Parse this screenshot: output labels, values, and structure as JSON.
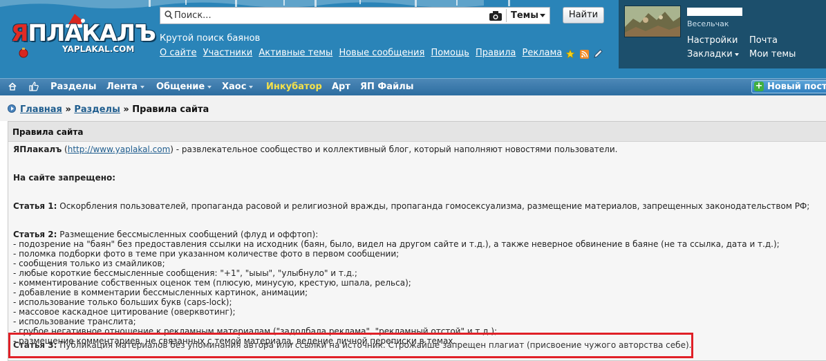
{
  "header": {
    "logo_text": "ЯПЛАКАЛЪ",
    "logo_sub": "YAPLAKAL.COM",
    "search": {
      "placeholder": "Поиск...",
      "scope": "Темы",
      "button": "Найти"
    },
    "tagline": "Крутой поиск баянов",
    "links": [
      "О сайте",
      "Участники",
      "Активные темы",
      "Новые сообщения",
      "Помощь",
      "Правила",
      "Реклама"
    ],
    "user": {
      "title": "Весельчак",
      "links": {
        "settings": "Настройки",
        "mail": "Почта",
        "bookmarks": "Закладки",
        "my_topics": "Мои темы"
      }
    }
  },
  "nav": {
    "items": [
      {
        "label": "Разделы",
        "dropdown": false
      },
      {
        "label": "Лента",
        "dropdown": true
      },
      {
        "label": "Общение",
        "dropdown": true
      },
      {
        "label": "Хаос",
        "dropdown": true
      },
      {
        "label": "Инкубатор",
        "dropdown": false
      },
      {
        "label": "Арт",
        "dropdown": false
      },
      {
        "label": "ЯП Файлы",
        "dropdown": false
      }
    ],
    "new_post": "Новый пост"
  },
  "breadcrumb": {
    "home": "Главная",
    "sections": "Разделы",
    "sep": "»",
    "current": "Правила сайта"
  },
  "rules": {
    "title": "Правила сайта",
    "intro_name": "ЯПлакалъ",
    "intro_url": "http://www.yaplakal.com",
    "intro_rest": " - развлекательное сообщество и коллективный блог, который наполняют новостями пользователи.",
    "forbidden": "На сайте запрещено:",
    "art1_label": "Статья 1:",
    "art1_text": " Оскорбления пользователей, пропаганда расовой и религиозной вражды, пропаганда гомосексуализма, размещение материалов, запрещенных законодательством РФ;",
    "art2_label": "Статья 2:",
    "art2_text": " Размещение бессмысленных сообщений (флуд и оффтоп):",
    "art2_items": [
      "- подозрение на \"баян\" без предоставления ссылки на исходник (баян, было, видел на другом сайте и т.д.), а также неверное обвинение в баяне (не та ссылка, дата и т.д.);",
      "- поломка подборки фото в теме при указанном количестве фото в первом сообщении;",
      "- сообщения только из смайликов;",
      "- любые короткие бессмысленные сообщения: \"+1\", \"ыыы\", \"улыбнуло\" и т.д.;",
      "- комментирование собственных оценок тем (плюсую, минусую, крестую, шпала, рельса);",
      "- добавление в комментарии бессмысленных картинок, анимации;",
      "- использование только больших букв (caps-lock);",
      "- массовое каскадное цитирование (оверквотинг);",
      "- использование транслита;",
      "- грубое негативное отношение к рекламным материалам (\"задолбала реклама\", \"рекламный отстой\" и т.д.);",
      "- размещение комментариев, не связанных с темой материала, ведение личной переписки в темах."
    ],
    "art3_label": "Статья 3:",
    "art3_text": " Публикация материалов без упоминания автора или ссылки на источник. Строжайше запрещен плагиат (присвоение чужого авторства себе)."
  },
  "colors": {
    "header_bg": "#2a84b8",
    "user_panel": "#1c4f6c",
    "nav_bg": "#3a79ab",
    "incubator": "#f5e14a",
    "highlight": "#e02027",
    "link": "#1f5d8e"
  }
}
